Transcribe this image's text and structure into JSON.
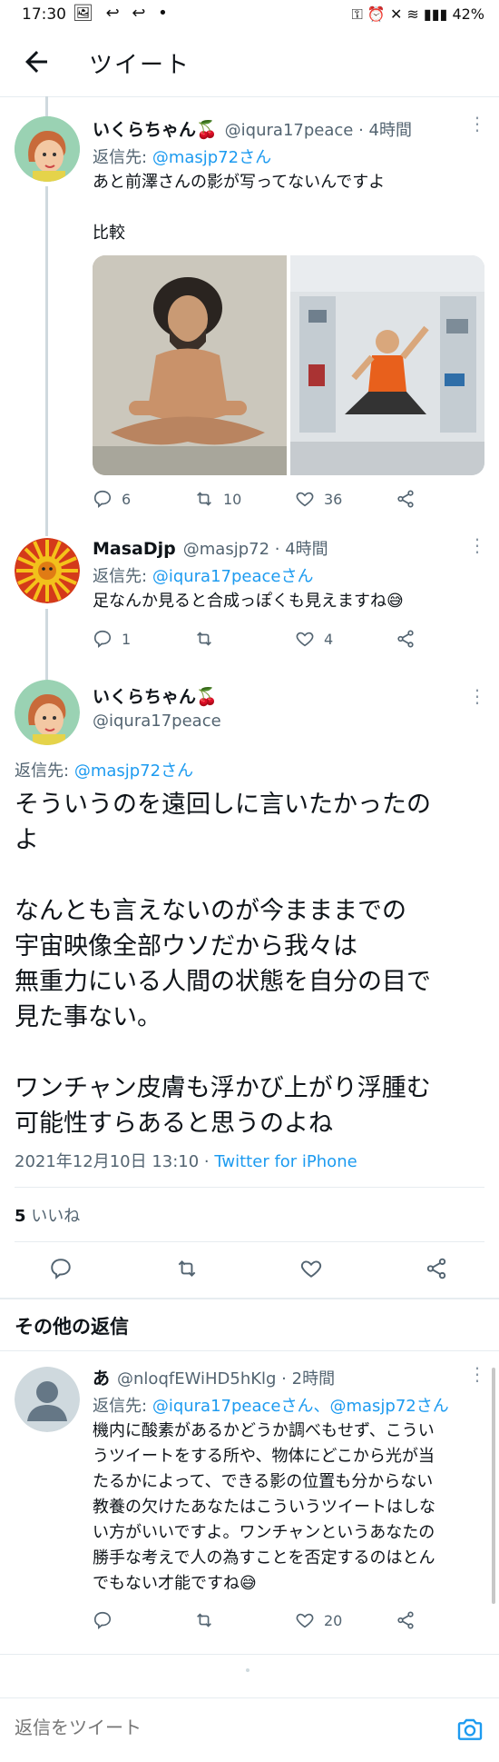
{
  "statusbar": {
    "time": "17:30",
    "battery": "42%"
  },
  "header": {
    "title": "ツイート"
  },
  "tweets": [
    {
      "name": "いくらちゃん🍒",
      "handle": "@iqura17peace · 4時間",
      "reply_label": "返信先:",
      "reply_to": "@masjp72さん",
      "text_1": "あと前澤さんの影が写ってないんですよ",
      "text_2": "比較",
      "replies": "6",
      "retweets": "10",
      "likes": "36"
    },
    {
      "name": "MasaDjp",
      "handle": "@masjp72 · 4時間",
      "reply_label": "返信先:",
      "reply_to": "@iqura17peaceさん",
      "text_1": "足なんか見ると合成っぽくも見えますね😅",
      "replies": "1",
      "retweets": "",
      "likes": "4"
    }
  ],
  "main_tweet": {
    "name": "いくらちゃん🍒",
    "handle": "@iqura17peace",
    "reply_label": "返信先:",
    "reply_to": "@masjp72さん",
    "lines": [
      "そういうのを遠回しに言いたかったの",
      "よ",
      "",
      "なんとも言えないのが今まままでの",
      "宇宙映像全部ウソだから我々は",
      "無重力にいる人間の状態を自分の目で",
      "見た事ない。",
      "",
      "ワンチャン皮膚も浮かび上がり浮腫む",
      "可能性すらあると思うのよね"
    ],
    "date": "2021年12月10日 13:10 · ",
    "source": "Twitter for iPhone",
    "likes_count": "5",
    "likes_label": "いいね"
  },
  "other_replies": {
    "title": "その他の返信"
  },
  "reply_tweet": {
    "name": "あ",
    "handle": "@nloqfEWiHD5hKlg · 2時間",
    "reply_label": "返信先:",
    "reply_to": "@iqura17peaceさん、@masjp72さん",
    "lines": [
      "機内に酸素があるかどうか調べもせず、こうい",
      "うツイートをする所や、物体にどこから光が当",
      "たるかによって、できる影の位置も分からない",
      "教養の欠けたあなたはこういうツイートはしな",
      "い方がいいですよ。ワンチャンというあなたの",
      "勝手な考えで人の為すことを否定するのはとん",
      "でもない才能ですね😅"
    ],
    "replies": "",
    "retweets": "",
    "likes": "20"
  },
  "composer": {
    "placeholder": "返信をツイート"
  },
  "colors": {
    "link": "#1d9bf0",
    "muted": "#536471",
    "divider": "#e6ecf0"
  }
}
